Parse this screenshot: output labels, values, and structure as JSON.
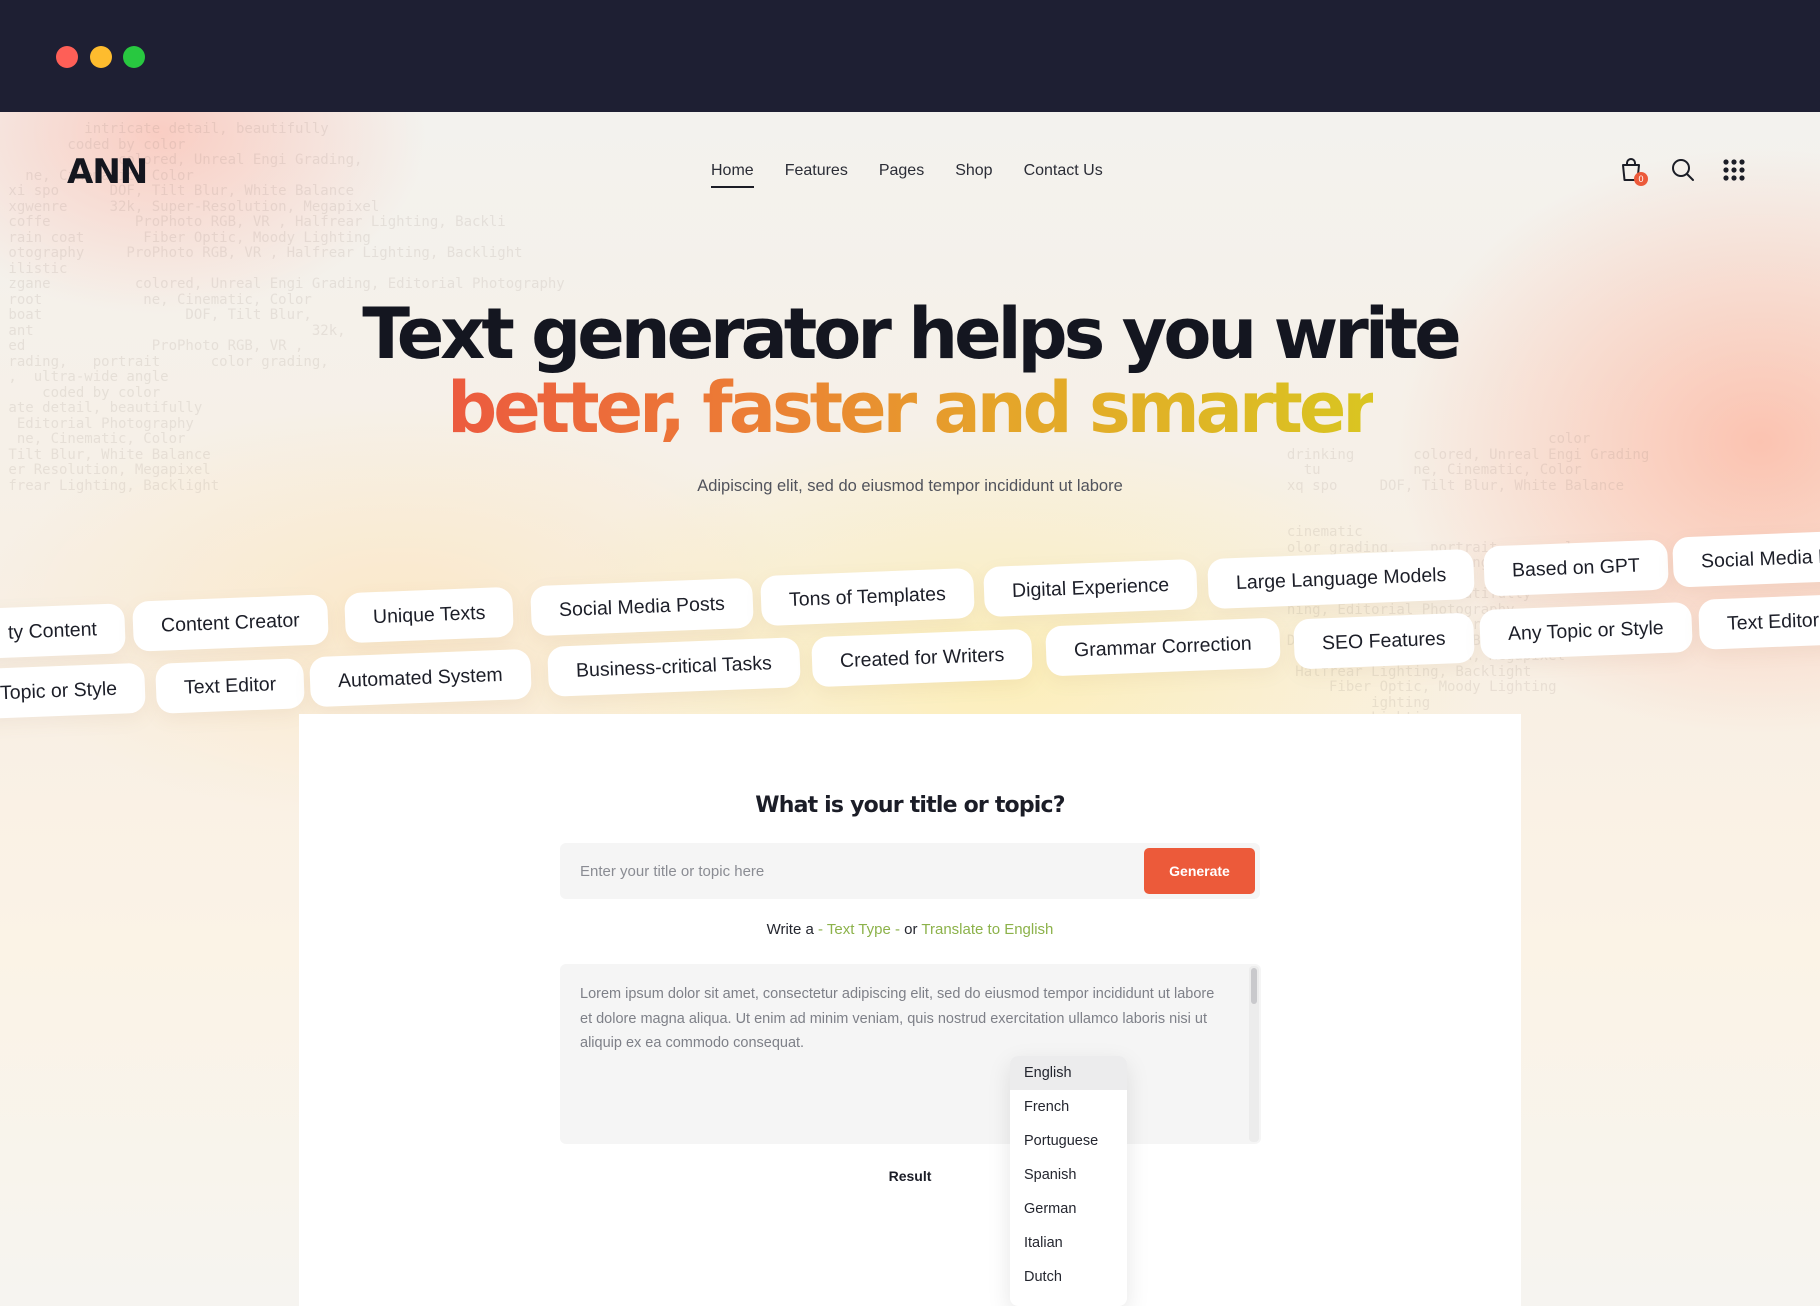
{
  "brand": {
    "logo": "ANN"
  },
  "nav": {
    "items": [
      {
        "label": "Home",
        "active": true
      },
      {
        "label": "Features"
      },
      {
        "label": "Pages"
      },
      {
        "label": "Shop"
      },
      {
        "label": "Contact Us"
      }
    ]
  },
  "header_icons": {
    "cart_icon": "shopping-bag-icon",
    "cart_count": "0",
    "search_icon": "search-icon",
    "menu_icon": "grid-menu-icon"
  },
  "hero": {
    "title_line1": "Text generator helps you write",
    "title_line2": "better, faster and smarter",
    "subtitle": "Adipiscing elit, sed do eiusmod tempor incididunt ut labore",
    "gradient_colors": [
      "#ec5a3f",
      "#ec7a36",
      "#e5a52a",
      "#d9c521"
    ]
  },
  "tags": {
    "row1": [
      "ty Content",
      "Content Creator",
      "Unique Texts",
      "Social Media Posts",
      "Tons of Templates",
      "Digital Experience",
      "Large Language Models",
      "Based on GPT",
      "Social Media P"
    ],
    "row2": [
      "Topic or Style",
      "Text Editor",
      "Automated System",
      "Business-critical Tasks",
      "Created for Writers",
      "Grammar Correction",
      "SEO Features",
      "Any Topic or Style",
      "Text Editor"
    ]
  },
  "scroll_icon": "arrow-down-icon",
  "generator": {
    "title": "What is your title or topic?",
    "input_placeholder": "Enter your title or topic here",
    "generate_label": "Generate",
    "write_prefix": "Write a",
    "text_type": "- Text Type -",
    "or_label": "or",
    "translate_label": "Translate to English",
    "body_text": "Lorem ipsum dolor sit amet, consectetur adipiscing elit, sed do eiusmod tempor incididunt ut labore et dolore magna aliqua. Ut enim ad minim veniam, quis nostrud exercitation ullamco laboris nisi ut aliquip ex ea commodo consequat.",
    "result_label": "Result"
  },
  "languages": {
    "selected": "English",
    "options": [
      "English",
      "French",
      "Portuguese",
      "Spanish",
      "German",
      "Italian",
      "Dutch"
    ]
  },
  "colors": {
    "accent": "#ec5a3a",
    "link_green": "#8cb24a",
    "chrome": "#1e1f33"
  }
}
